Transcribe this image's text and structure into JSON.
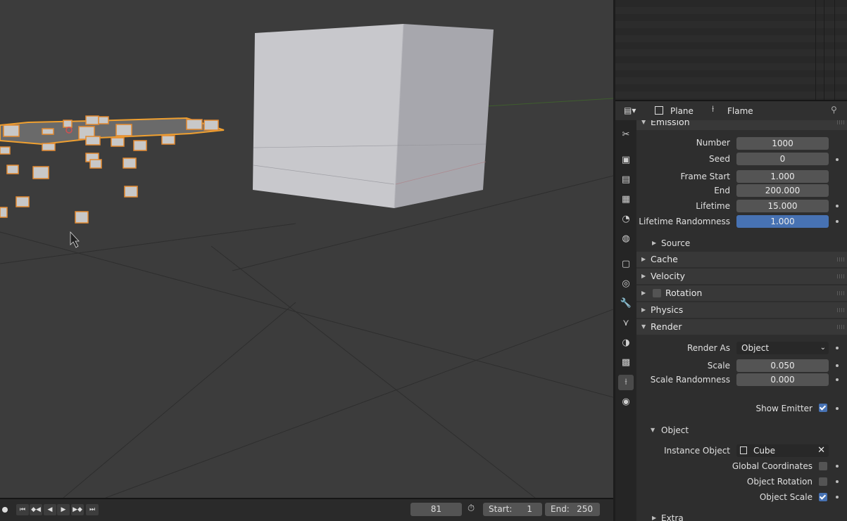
{
  "properties": {
    "header": {
      "object_name": "Plane",
      "system_name": "Flame"
    },
    "tabs": [
      "tool-icon",
      "render-icon",
      "output-icon",
      "view-layer-icon",
      "scene-icon",
      "world-icon",
      "object-icon",
      "physics-icon",
      "modifier-icon",
      "particles-icon",
      "material-icon",
      "texture-icon",
      "particle-system-icon",
      "constraints-icon"
    ],
    "emission": {
      "title": "Emission",
      "number_label": "Number",
      "number": "1000",
      "seed_label": "Seed",
      "seed": "0",
      "frame_start_label": "Frame Start",
      "frame_start": "1.000",
      "end_label": "End",
      "end": "200.000",
      "lifetime_label": "Lifetime",
      "lifetime": "15.000",
      "lifetime_randomness_label": "Lifetime Randomness",
      "lifetime_randomness": "1.000",
      "source_label": "Source"
    },
    "panels": {
      "cache": "Cache",
      "velocity": "Velocity",
      "rotation": "Rotation",
      "physics": "Physics",
      "render": "Render"
    },
    "render": {
      "render_as_label": "Render As",
      "render_as": "Object",
      "scale_label": "Scale",
      "scale": "0.050",
      "scale_randomness_label": "Scale Randomness",
      "scale_randomness": "0.000",
      "show_emitter_label": "Show Emitter",
      "show_emitter": true,
      "object_sub": "Object",
      "instance_object_label": "Instance Object",
      "instance_object": "Cube",
      "global_coordinates_label": "Global Coordinates",
      "global_coordinates": false,
      "object_rotation_label": "Object Rotation",
      "object_rotation": false,
      "object_scale_label": "Object Scale",
      "object_scale": true,
      "extra_label": "Extra"
    }
  },
  "timeline": {
    "current_frame": "81",
    "start_label": "Start:",
    "start": "1",
    "end_label": "End:",
    "end": "250"
  },
  "colors": {
    "accent": "#4772b3",
    "selection_outline": "#f0a030"
  }
}
